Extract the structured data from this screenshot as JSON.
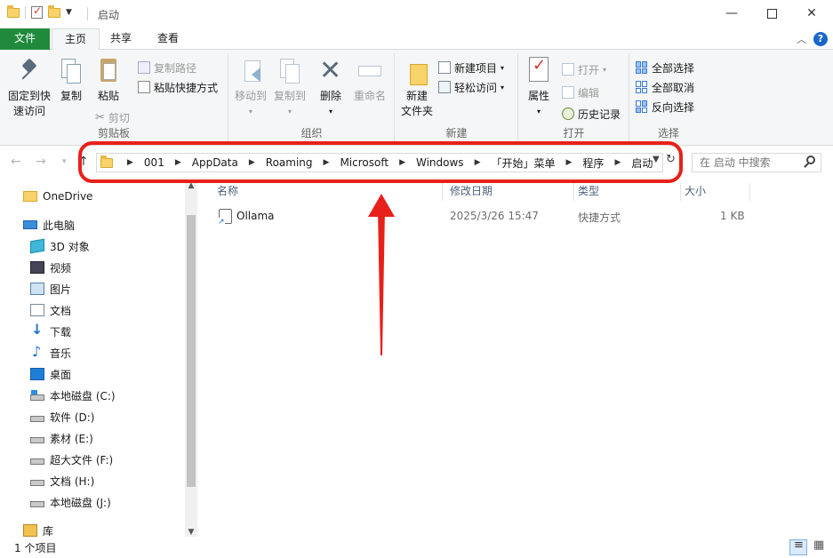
{
  "window": {
    "title": "启动"
  },
  "ribbon_tabs": [
    "文件",
    "主页",
    "共享",
    "查看"
  ],
  "ribbon": {
    "clipboard": {
      "pin_label": [
        "固定到快",
        "速访问"
      ],
      "copy_label": "复制",
      "paste_label": "粘贴",
      "copy_path_label": "复制路径",
      "paste_shortcut_label": "粘贴快捷方式",
      "cut_label": "剪切",
      "group_label": "剪贴板"
    },
    "organize": {
      "move_to_label": "移动到",
      "copy_to_label": "复制到",
      "delete_label": "删除",
      "rename_label": "重命名",
      "group_label": "组织"
    },
    "new": {
      "new_item_label": "新建项目",
      "easy_access_label": "轻松访问",
      "new_folder_label": [
        "新建",
        "文件夹"
      ],
      "group_label": "新建"
    },
    "open": {
      "properties_label": "属性",
      "open_label": "打开",
      "edit_label": "编辑",
      "history_label": "历史记录",
      "group_label": "打开"
    },
    "select": {
      "select_all_label": "全部选择",
      "select_none_label": "全部取消",
      "invert_label": "反向选择",
      "group_label": "选择"
    }
  },
  "address": {
    "breadcrumbs": [
      "001",
      "AppData",
      "Roaming",
      "Microsoft",
      "Windows",
      "「开始」菜单",
      "程序",
      "启动"
    ]
  },
  "search": {
    "placeholder": "在 启动 中搜索"
  },
  "nav_pane": {
    "items": [
      {
        "label": "OneDrive",
        "icon": "folder-icon"
      },
      {
        "label": "此电脑",
        "icon": "computer-icon"
      },
      {
        "label": "3D 对象",
        "icon": "3d-objects-icon"
      },
      {
        "label": "视频",
        "icon": "video-icon"
      },
      {
        "label": "图片",
        "icon": "pictures-icon"
      },
      {
        "label": "文档",
        "icon": "documents-icon"
      },
      {
        "label": "下载",
        "icon": "download-icon"
      },
      {
        "label": "音乐",
        "icon": "music-icon"
      },
      {
        "label": "桌面",
        "icon": "desktop-icon"
      },
      {
        "label": "本地磁盘 (C:)",
        "icon": "system-drive-icon"
      },
      {
        "label": "软件 (D:)",
        "icon": "drive-icon"
      },
      {
        "label": "素材 (E:)",
        "icon": "drive-icon"
      },
      {
        "label": "超大文件 (F:)",
        "icon": "drive-icon"
      },
      {
        "label": "文档 (H:)",
        "icon": "drive-icon"
      },
      {
        "label": "本地磁盘 (J:)",
        "icon": "drive-icon"
      },
      {
        "label": "库",
        "icon": "library-icon"
      }
    ]
  },
  "file_list": {
    "columns": [
      "名称",
      "修改日期",
      "类型",
      "大小"
    ],
    "rows": [
      {
        "name": "Ollama",
        "modified": "2025/3/26 15:47",
        "type": "快捷方式",
        "size": "1 KB"
      }
    ]
  },
  "status": {
    "item_count": "1 个项目"
  },
  "colors": {
    "file_tab": "#1f8a3c",
    "annotation_red": "#e8201a",
    "accent_blue": "#1a66c9"
  }
}
